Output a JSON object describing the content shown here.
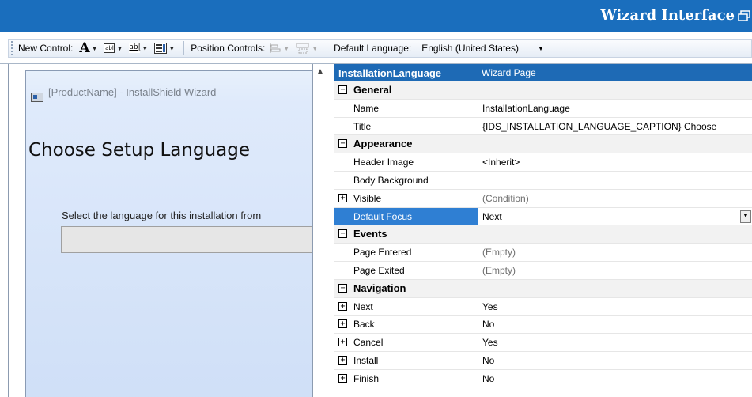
{
  "window": {
    "title": "Wizard Interface"
  },
  "toolbar": {
    "new_control_label": "New Control:",
    "position_controls_label": "Position Controls:",
    "default_language_label": "Default Language:",
    "default_language_value": "English (United States)",
    "text_tool_label": "A",
    "edit_tool_label": "abl",
    "edit_tool_2_label": "ab|"
  },
  "preview": {
    "window_title": "[ProductName] - InstallShield Wizard",
    "heading": "Choose Setup Language",
    "prompt": "Select the language for this installation from"
  },
  "grid": {
    "header_name": "InstallationLanguage",
    "header_value": "Wizard Page",
    "rows": [
      {
        "type": "cat",
        "toggle": "−",
        "label": "General"
      },
      {
        "type": "prop",
        "name": "Name",
        "value": "InstallationLanguage"
      },
      {
        "type": "prop",
        "name": "Title",
        "value": "{IDS_INSTALLATION_LANGUAGE_CAPTION} Choose"
      },
      {
        "type": "cat",
        "toggle": "−",
        "label": "Appearance"
      },
      {
        "type": "prop",
        "name": "Header Image",
        "value": "<Inherit>"
      },
      {
        "type": "prop",
        "name": "Body Background",
        "value": ""
      },
      {
        "type": "prop",
        "toggle": "+",
        "name": "Visible",
        "value": "(Condition)",
        "muted": true
      },
      {
        "type": "prop",
        "name": "Default Focus",
        "value": "Next",
        "selected": true,
        "dropdown": true
      },
      {
        "type": "cat",
        "toggle": "−",
        "label": "Events"
      },
      {
        "type": "prop",
        "name": "Page Entered",
        "value": "(Empty)",
        "muted": true
      },
      {
        "type": "prop",
        "name": "Page Exited",
        "value": "(Empty)",
        "muted": true
      },
      {
        "type": "cat",
        "toggle": "−",
        "label": "Navigation"
      },
      {
        "type": "prop",
        "toggle": "+",
        "name": "Next",
        "value": "Yes"
      },
      {
        "type": "prop",
        "toggle": "+",
        "name": "Back",
        "value": "No"
      },
      {
        "type": "prop",
        "toggle": "+",
        "name": "Cancel",
        "value": "Yes"
      },
      {
        "type": "prop",
        "toggle": "+",
        "name": "Install",
        "value": "No"
      },
      {
        "type": "prop",
        "toggle": "+",
        "name": "Finish",
        "value": "No"
      }
    ]
  },
  "colors": {
    "titlebar": "#1a6ebd",
    "grid_header": "#1e6ab5",
    "selection": "#2f7fd3"
  }
}
